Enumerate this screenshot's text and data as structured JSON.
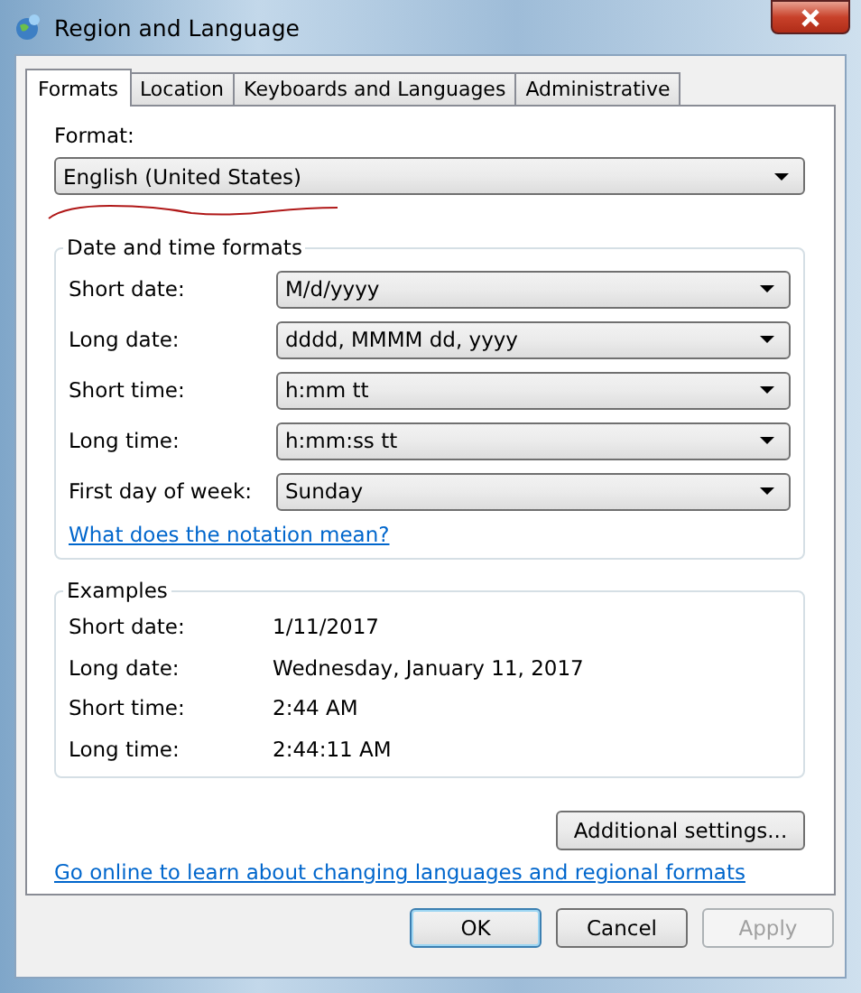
{
  "window": {
    "title": "Region and Language"
  },
  "tabs": [
    {
      "label": "Formats",
      "selected": true
    },
    {
      "label": "Location",
      "selected": false
    },
    {
      "label": "Keyboards and Languages",
      "selected": false
    },
    {
      "label": "Administrative",
      "selected": false
    }
  ],
  "format": {
    "label": "Format:",
    "value": "English (United States)"
  },
  "date_time_formats": {
    "title": "Date and time formats",
    "rows": [
      {
        "label": "Short date:",
        "value": "M/d/yyyy"
      },
      {
        "label": "Long date:",
        "value": "dddd, MMMM dd, yyyy"
      },
      {
        "label": "Short time:",
        "value": "h:mm tt"
      },
      {
        "label": "Long time:",
        "value": "h:mm:ss tt"
      },
      {
        "label": "First day of week:",
        "value": "Sunday"
      }
    ],
    "link": "What does the notation mean?"
  },
  "examples": {
    "title": "Examples",
    "rows": [
      {
        "label": "Short date:",
        "value": "1/11/2017"
      },
      {
        "label": "Long date:",
        "value": "Wednesday, January 11, 2017"
      },
      {
        "label": "Short time:",
        "value": "2:44 AM"
      },
      {
        "label": "Long time:",
        "value": "2:44:11 AM"
      }
    ]
  },
  "additional_settings_button": "Additional settings...",
  "online_link": "Go online to learn about changing languages and regional formats",
  "buttons": [
    {
      "label": "OK",
      "default": true,
      "disabled": false
    },
    {
      "label": "Cancel",
      "default": false,
      "disabled": false
    },
    {
      "label": "Apply",
      "default": false,
      "disabled": true
    }
  ]
}
